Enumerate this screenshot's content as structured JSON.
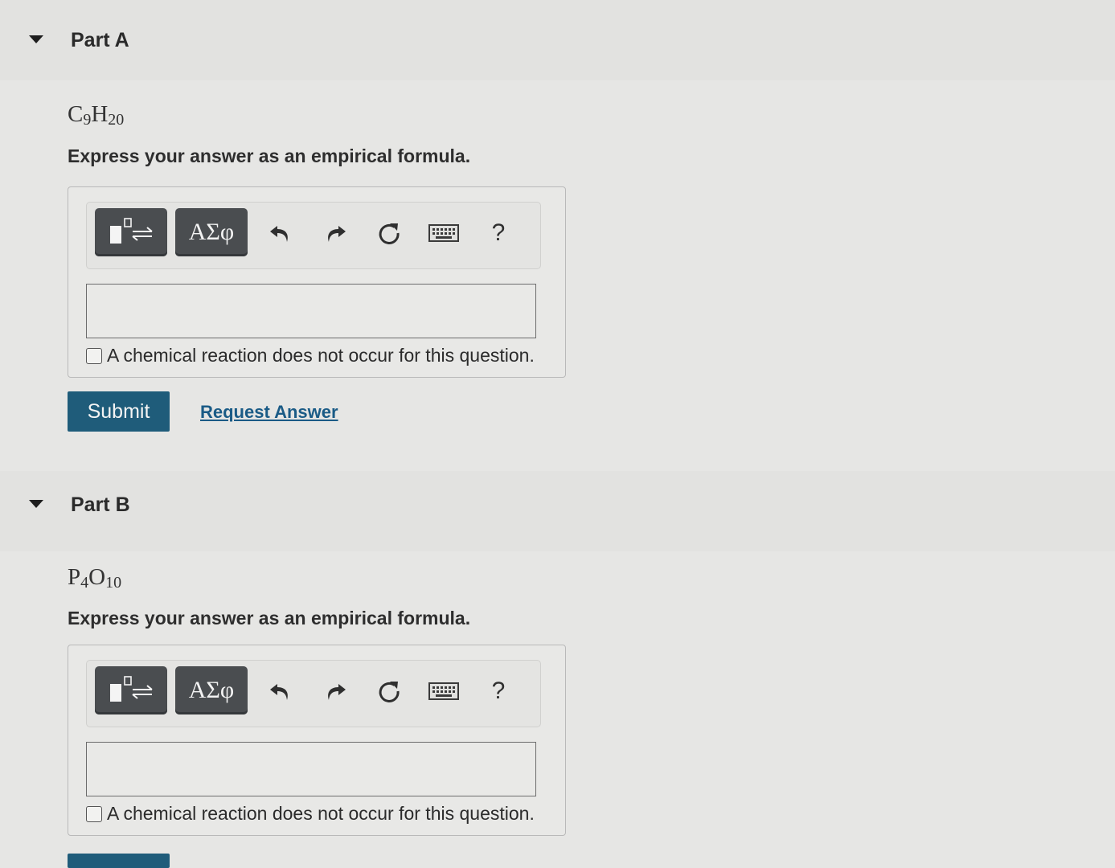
{
  "parts": [
    {
      "title": "Part A",
      "formula": {
        "el1": "C",
        "sub1": "9",
        "el2": "H",
        "sub2": "20"
      },
      "instruction": "Express your answer as an empirical formula.",
      "toolbar": {
        "greek_label": "ΑΣφ",
        "help_label": "?"
      },
      "input_value": "",
      "no_reaction_label": "A chemical reaction does not occur for this question.",
      "submit_label": "Submit",
      "request_label": "Request Answer"
    },
    {
      "title": "Part B",
      "formula": {
        "el1": "P",
        "sub1": "4",
        "el2": "O",
        "sub2": "10"
      },
      "instruction": "Express your answer as an empirical formula.",
      "toolbar": {
        "greek_label": "ΑΣφ",
        "help_label": "?"
      },
      "input_value": "",
      "no_reaction_label": "A chemical reaction does not occur for this question.",
      "submit_label": ""
    }
  ],
  "icons": [
    "template-icon",
    "undo-icon",
    "redo-icon",
    "reset-icon",
    "keyboard-icon"
  ]
}
